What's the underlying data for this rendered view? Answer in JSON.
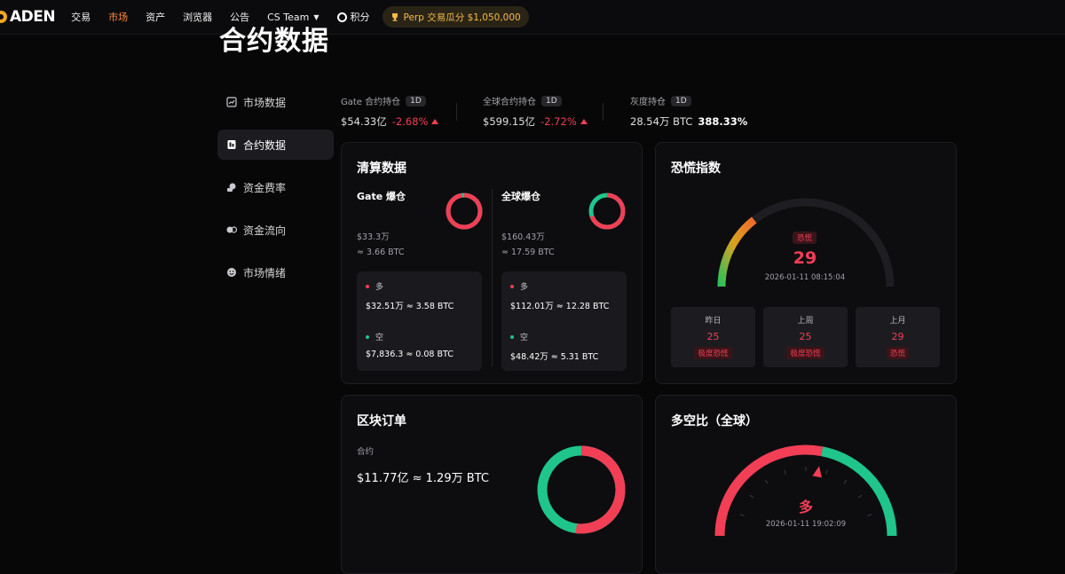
{
  "nav": {
    "logo": "ADEN",
    "items": [
      "交易",
      "市场",
      "资产",
      "浏览器",
      "公告"
    ],
    "team": "CS Team",
    "points": "积分",
    "promo": "Perp 交易瓜分 $1,050,000"
  },
  "page_title": "合约数据",
  "sidebar": {
    "items": [
      {
        "label": "市场数据",
        "icon": "chart-icon"
      },
      {
        "label": "合约数据",
        "icon": "contract-icon"
      },
      {
        "label": "资金费率",
        "icon": "funding-icon"
      },
      {
        "label": "资金流向",
        "icon": "flow-icon"
      },
      {
        "label": "市场情绪",
        "icon": "smile-icon"
      }
    ],
    "active_index": 1
  },
  "stats": [
    {
      "label": "Gate 合约持仓",
      "period": "1D",
      "value": "$54.33亿",
      "change": "-2.68%"
    },
    {
      "label": "全球合约持仓",
      "period": "1D",
      "value": "$599.15亿",
      "change": "-2.72%"
    },
    {
      "label": "灰度持仓",
      "period": "1D",
      "value": "28.54万 BTC",
      "change": "388.33%"
    }
  ],
  "liquidation": {
    "title": "清算数据",
    "gate": {
      "name": "Gate 爆仓",
      "total": "$33.3万",
      "total_btc": "≈ 3.66 BTC",
      "long_label": "多",
      "long_value": "$32.51万 ≈ 3.58 BTC",
      "short_label": "空",
      "short_value": "$7,836.3 ≈ 0.08 BTC",
      "long_share": 0.976
    },
    "global": {
      "name": "全球爆仓",
      "total": "$160.43万",
      "total_btc": "≈ 17.59 BTC",
      "long_label": "多",
      "long_value": "$112.01万 ≈ 12.28 BTC",
      "short_label": "空",
      "short_value": "$48.42万 ≈ 5.31 BTC",
      "long_share": 0.698
    }
  },
  "fear_greed": {
    "title": "恐慌指数",
    "label": "恐慌",
    "value": 29,
    "timestamp": "2026-01-11 08:15:04",
    "history": [
      {
        "label": "昨日",
        "value": "25",
        "tag": "极度恐慌"
      },
      {
        "label": "上周",
        "value": "25",
        "tag": "极度恐慌"
      },
      {
        "label": "上月",
        "value": "29",
        "tag": "恐慌"
      }
    ]
  },
  "block_orders": {
    "title": "区块订单",
    "label": "合约",
    "value": "$11.77亿 ≈ 1.29万 BTC",
    "red_share": 0.52
  },
  "long_short": {
    "title": "多空比（全球）",
    "label": "多",
    "timestamp": "2026-01-11 19:02:09",
    "long_share": 0.56
  },
  "colors": {
    "long": "#f23f56",
    "short": "#1fc58b",
    "accent": "#ff8a3d"
  }
}
